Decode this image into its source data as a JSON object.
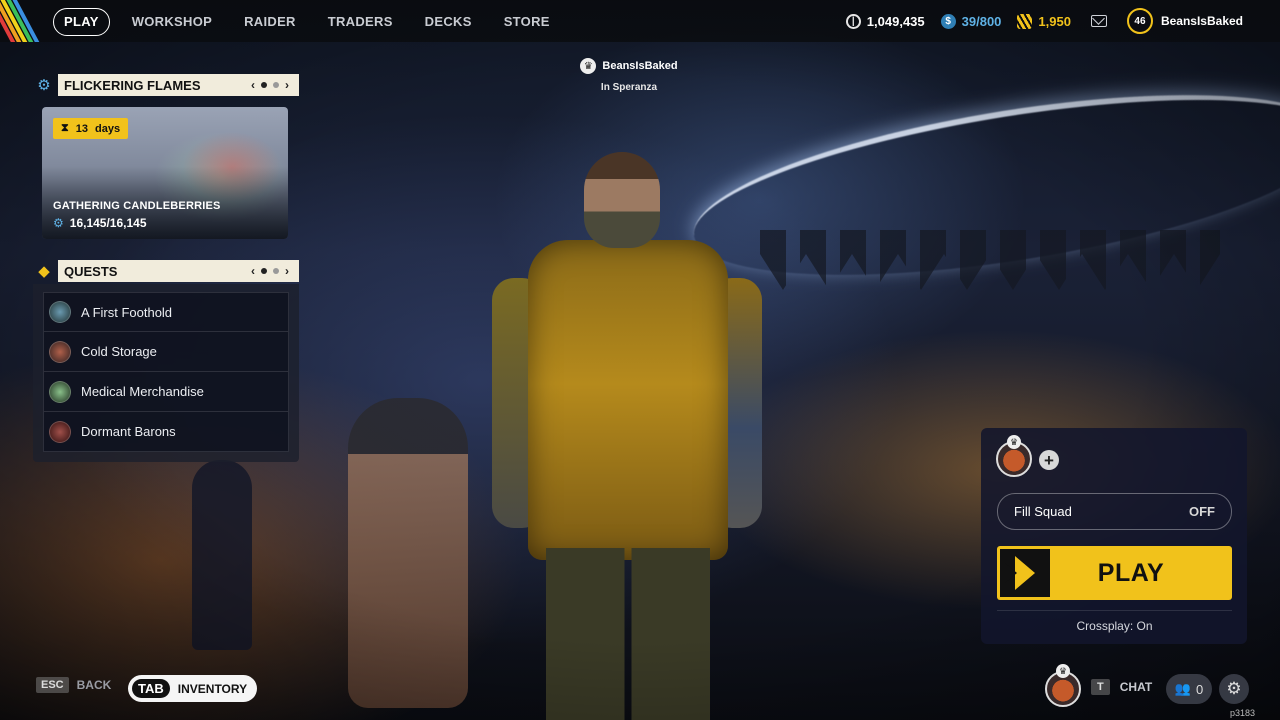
{
  "nav": {
    "items": [
      "PLAY",
      "WORKSHOP",
      "RAIDER",
      "TRADERS",
      "DECKS",
      "STORE"
    ],
    "active_index": 0
  },
  "currencies": {
    "coins": "1,049,435",
    "credits": "39/800",
    "tokens": "1,950"
  },
  "profile": {
    "level": "46",
    "name": "BeansIsBaked"
  },
  "player_tag": {
    "name": "BeansIsBaked",
    "location": "In Speranza"
  },
  "event": {
    "header": "FLICKERING FLAMES",
    "timer_value": "13",
    "timer_unit": "days",
    "title": "GATHERING CANDLEBERRIES",
    "progress": "16,145/16,145"
  },
  "quests": {
    "header": "QUESTS",
    "items": [
      "A First Foothold",
      "Cold Storage",
      "Medical Merchandise",
      "Dormant Barons"
    ]
  },
  "squad": {
    "fill_label": "Fill Squad",
    "fill_value": "OFF",
    "play_label": "PLAY",
    "crossplay": "Crossplay: On"
  },
  "bottom": {
    "back_key": "ESC",
    "back_label": "BACK",
    "inventory_key": "TAB",
    "inventory_label": "INVENTORY",
    "chat_key": "T",
    "chat_label": "CHAT",
    "friends_count": "0",
    "build": "p3183"
  },
  "colors": {
    "accent_yellow": "#f1c21b",
    "credit_blue": "#5fb2e6",
    "panel_cream": "#f1ecdc",
    "squad_bg": "#12162c"
  }
}
